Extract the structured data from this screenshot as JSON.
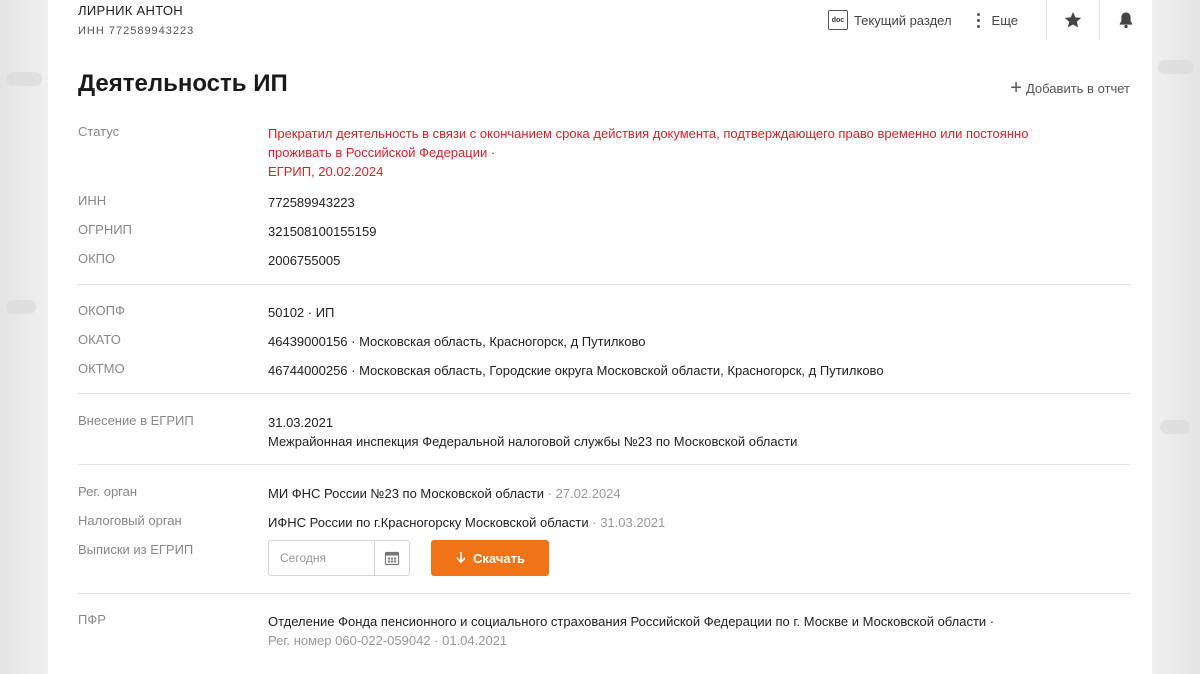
{
  "header": {
    "company_name": "ЛИРНИК АНТОН",
    "company_inn": "ИНН 772589943223",
    "current_section_label": "Текущий раздел",
    "more_label": "Еще",
    "doc_icon_text": "doc"
  },
  "page": {
    "title": "Деятельность ИП",
    "add_report_label": "Добавить в отчет"
  },
  "rows": {
    "status": {
      "label": "Статус",
      "line1": "Прекратил деятельность в связи с окончанием срока действия документа, подтверждающего право временно или постоянно",
      "line2": "проживать в Российской Федерации ·",
      "line3": "ЕГРИП, 20.02.2024"
    },
    "inn": {
      "label": "ИНН",
      "value": "772589943223"
    },
    "ogrnip": {
      "label": "ОГРНИП",
      "value": "321508100155159"
    },
    "okpo": {
      "label": "ОКПО",
      "value": "2006755005"
    },
    "okopf": {
      "label": "ОКОПФ",
      "value": "50102 · ИП"
    },
    "okato": {
      "label": "ОКАТО",
      "value": "46439000156 · Московская область, Красногорск, д Путилково"
    },
    "oktmo": {
      "label": "ОКТМО",
      "value": "46744000256 · Московская область, Городские округа Московской области, Красногорск, д Путилково"
    },
    "egrip_entry": {
      "label": "Внесение в ЕГРИП",
      "date": "31.03.2021",
      "authority": "Межрайонная инспекция Федеральной налоговой службы №23 по Московской области"
    },
    "reg_organ": {
      "label": "Рег. орган",
      "value": "МИ ФНС России №23 по Московской области",
      "date": "· 27.02.2024"
    },
    "tax_organ": {
      "label": "Налоговый орган",
      "value": "ИФНС России по г.Красногорску Московской области",
      "date": "· 31.03.2021"
    },
    "extracts": {
      "label": "Выписки из ЕГРИП",
      "date_placeholder": "Сегодня",
      "download_label": "Скачать"
    },
    "pfr": {
      "label": "ПФР",
      "line1": "Отделение Фонда пенсионного и социального страхования Российской Федерации по г. Москве и Московской области ·",
      "line2": "Рег. номер 060-022-059042 · 01.04.2021"
    }
  },
  "colors": {
    "status_red": "#d4232b",
    "accent_orange": "#f07317"
  }
}
